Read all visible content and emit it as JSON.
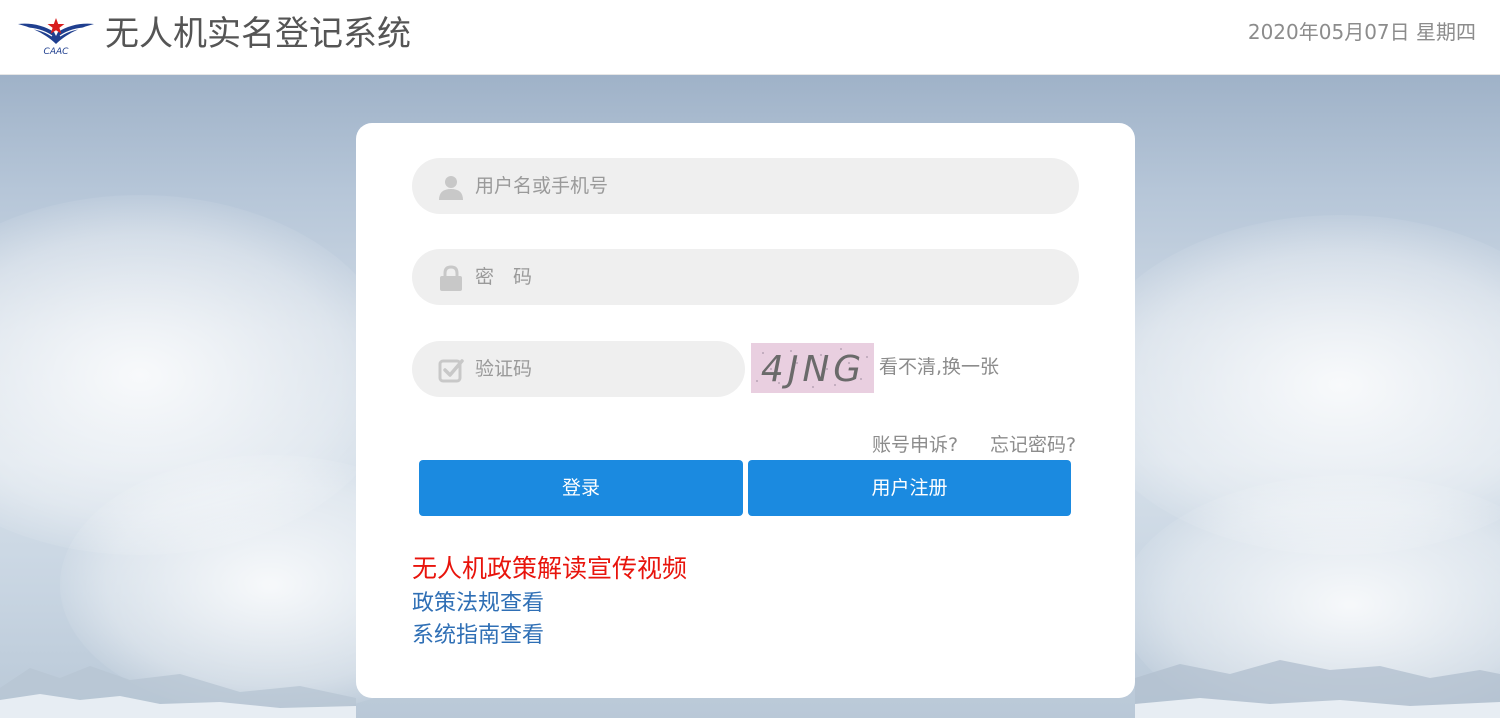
{
  "header": {
    "logo_text": "CAAC",
    "title": "无人机实名登记系统",
    "date": "2020年05月07日 星期四"
  },
  "login": {
    "username_placeholder": "用户名或手机号",
    "password_placeholder": "密　码",
    "captcha_placeholder": "验证码",
    "captcha_code": "4JNG",
    "captcha_refresh": "看不清,换一张",
    "appeal_link": "账号申诉?",
    "forgot_link": "忘记密码?",
    "login_button": "登录",
    "register_button": "用户注册"
  },
  "links": {
    "video": "无人机政策解读宣传视频",
    "policy": "政策法规查看",
    "guide": "系统指南查看"
  },
  "icons": {
    "user": "user-icon",
    "lock": "lock-icon",
    "check": "checkbox-icon",
    "logo": "caac-logo-icon"
  },
  "colors": {
    "primary_button": "#1b8ae0",
    "promo_red": "#e8140c",
    "link_blue": "#2f6fb5"
  }
}
